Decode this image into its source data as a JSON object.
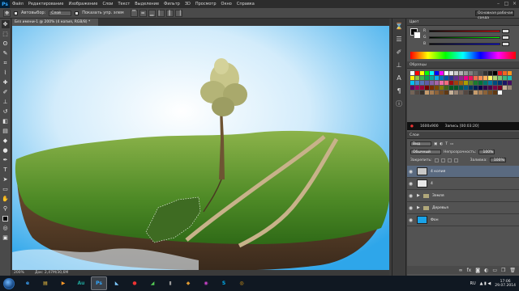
{
  "menubar": {
    "logo": "Ps",
    "items": [
      "Файл",
      "Редактирование",
      "Изображение",
      "Слои",
      "Текст",
      "Выделение",
      "Фильтр",
      "3D",
      "Просмотр",
      "Окно",
      "Справка"
    ],
    "controls": [
      "–",
      "□",
      "×"
    ]
  },
  "options": {
    "autoselect_label": "Автовыбор:",
    "autoselect_value": "Слой",
    "transform_label": "Показать упр. элем",
    "workspace": "Основная рабочая среда"
  },
  "document": {
    "tab_title": "Без имени-1 @ 200% (4 копия, RGB/8) *",
    "zoom": "200%",
    "info": "Док: 2,47M/30,6M"
  },
  "color_panel": {
    "tabs": [
      "Цвет",
      "Образцы"
    ],
    "sliders": [
      {
        "label": "R",
        "value": ""
      },
      {
        "label": "G",
        "value": ""
      },
      {
        "label": "B",
        "value": ""
      }
    ],
    "fg_color": "#000000",
    "bg_color": "#ffffff"
  },
  "swatches_panel": {
    "tabs": [
      "Образцы"
    ],
    "colors": [
      "#ffffff",
      "#ff0000",
      "#ffff00",
      "#00ff00",
      "#00ffff",
      "#0000ff",
      "#ff00ff",
      "#ffffff",
      "#e6e6e6",
      "#cccccc",
      "#b3b3b3",
      "#999999",
      "#808080",
      "#666666",
      "#4d4d4d",
      "#333333",
      "#1a1a1a",
      "#000000",
      "#ee1d24",
      "#f16522",
      "#f7941d",
      "#fff200",
      "#8dc63f",
      "#39b54a",
      "#00a651",
      "#00a99d",
      "#00aeef",
      "#0072bc",
      "#0054a6",
      "#2e3192",
      "#662d91",
      "#92278f",
      "#ec008c",
      "#ed145b",
      "#f26c4f",
      "#f68e55",
      "#fbaf5c",
      "#fff467",
      "#acd372",
      "#7cc576",
      "#3bb878",
      "#1abbb4",
      "#00bff3",
      "#438ccb",
      "#5574b9",
      "#605ca8",
      "#8560a8",
      "#a864a8",
      "#f06eaa",
      "#f26d7d",
      "#9e0b0f",
      "#a0410d",
      "#a3620a",
      "#aba000",
      "#598527",
      "#197b30",
      "#007236",
      "#00746b",
      "#0076a3",
      "#004b80",
      "#003471",
      "#1b1464",
      "#440e62",
      "#630460",
      "#9e005d",
      "#9e0039",
      "#790000",
      "#7b2e00",
      "#7d4900",
      "#827b00",
      "#406618",
      "#005e20",
      "#005826",
      "#005952",
      "#005b7f",
      "#003663",
      "#002157",
      "#0d004c",
      "#32004b",
      "#4b0049",
      "#7b0046",
      "#7a0026",
      "#c7b299",
      "#998675",
      "#736357",
      "#534741",
      "#37302a",
      "#c69c6d",
      "#a67c52",
      "#8c6239",
      "#754c24",
      "#603913",
      "#c7b299",
      "#998675",
      "#736357",
      "#534741",
      "#37302a",
      "#c69c6d",
      "#a67c52",
      "#8c6239",
      "#754c24",
      "#603913",
      "#ffffff"
    ]
  },
  "recording": {
    "resolution": "1600x900",
    "status": "Запись [00:03:20]"
  },
  "layers_panel": {
    "tabs": [
      "Слои"
    ],
    "filter_label": "Вид",
    "blend_mode": "Обычный",
    "opacity_label": "Непрозрачность:",
    "opacity_value": "100%",
    "lock_label": "Закрепить:",
    "fill_label": "Заливка:",
    "fill_value": "100%",
    "layers": [
      {
        "name": "4 копия",
        "kind": "layer",
        "selected": true,
        "thumb": "#c8c8c8"
      },
      {
        "name": "4",
        "kind": "layer",
        "selected": false,
        "thumb": "#e8e8e8"
      },
      {
        "name": "Земля",
        "kind": "group",
        "selected": false,
        "thumb": ""
      },
      {
        "name": "Деревья",
        "kind": "group",
        "selected": false,
        "thumb": ""
      },
      {
        "name": "Фон",
        "kind": "layer",
        "selected": false,
        "thumb": "#1aa3e8"
      }
    ]
  },
  "taskbar": {
    "apps": [
      {
        "name": "ie",
        "glyph": "e",
        "color": "#3da7ff",
        "active": false
      },
      {
        "name": "explorer",
        "glyph": "▤",
        "color": "#f5c542",
        "active": false
      },
      {
        "name": "media",
        "glyph": "▶",
        "color": "#ff9a2a",
        "active": false
      },
      {
        "name": "audition",
        "glyph": "Au",
        "color": "#1fa59a",
        "active": false
      },
      {
        "name": "photoshop",
        "glyph": "Ps",
        "color": "#31a8ff",
        "active": true
      },
      {
        "name": "app6",
        "glyph": "◣",
        "color": "#7ec9ff",
        "active": false
      },
      {
        "name": "app7",
        "glyph": "●",
        "color": "#e33",
        "active": false
      },
      {
        "name": "app8",
        "glyph": "◢",
        "color": "#5c5",
        "active": false
      },
      {
        "name": "app9",
        "glyph": "▮",
        "color": "#999",
        "active": false
      },
      {
        "name": "app10",
        "glyph": "◆",
        "color": "#d93",
        "active": false
      },
      {
        "name": "app11",
        "glyph": "◉",
        "color": "#c4c",
        "active": false
      },
      {
        "name": "skype",
        "glyph": "S",
        "color": "#00aff0",
        "active": false
      },
      {
        "name": "chrome",
        "glyph": "◎",
        "color": "#e9a317",
        "active": false
      }
    ],
    "lang": "RU",
    "time": "17:06",
    "date": "29.07.2014"
  }
}
